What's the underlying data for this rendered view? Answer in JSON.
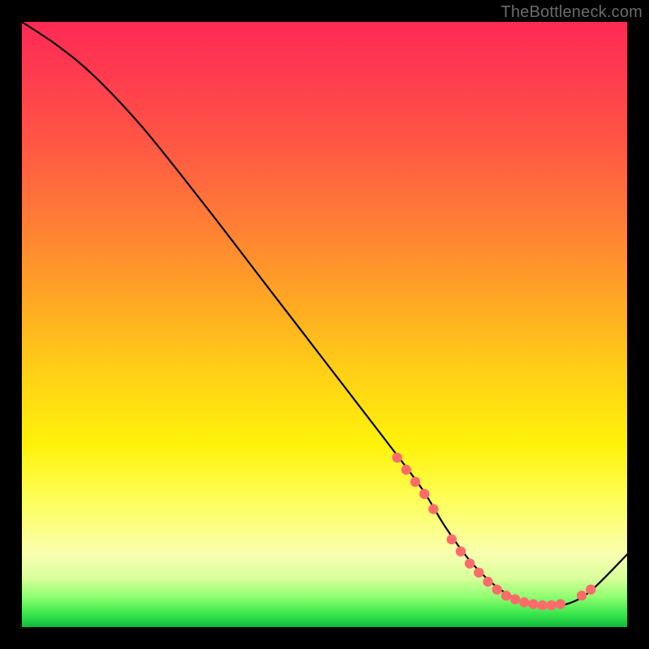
{
  "watermark": "TheBottleneck.com",
  "colors": {
    "curve_stroke": "#000000",
    "marker_fill": "#ff6b6b",
    "marker_stroke": "#c94a4a"
  },
  "chart_data": {
    "type": "line",
    "title": "",
    "xlabel": "",
    "ylabel": "",
    "xlim": [
      0,
      100
    ],
    "ylim": [
      0,
      100
    ],
    "series": [
      {
        "name": "curve",
        "x": [
          0,
          6,
          12,
          20,
          30,
          40,
          50,
          60,
          66,
          70,
          74,
          78,
          82,
          86,
          90,
          94,
          100
        ],
        "y": [
          100,
          96,
          91,
          82.5,
          70,
          57,
          44,
          31,
          23,
          16.5,
          11,
          7,
          4.5,
          3.5,
          3.8,
          6,
          12
        ]
      }
    ],
    "markers": [
      {
        "x": 62,
        "y": 28
      },
      {
        "x": 63.5,
        "y": 26
      },
      {
        "x": 65,
        "y": 24
      },
      {
        "x": 66.5,
        "y": 22
      },
      {
        "x": 68,
        "y": 19.5
      },
      {
        "x": 71,
        "y": 14.5
      },
      {
        "x": 72.5,
        "y": 12.5
      },
      {
        "x": 74,
        "y": 10.5
      },
      {
        "x": 75.5,
        "y": 9
      },
      {
        "x": 77,
        "y": 7.5
      },
      {
        "x": 78.5,
        "y": 6.2
      },
      {
        "x": 80,
        "y": 5.2
      },
      {
        "x": 81.5,
        "y": 4.6
      },
      {
        "x": 83,
        "y": 4.1
      },
      {
        "x": 84.5,
        "y": 3.8
      },
      {
        "x": 86,
        "y": 3.6
      },
      {
        "x": 87.5,
        "y": 3.6
      },
      {
        "x": 89,
        "y": 3.8
      },
      {
        "x": 92.5,
        "y": 5.2
      },
      {
        "x": 94,
        "y": 6.2
      }
    ]
  }
}
